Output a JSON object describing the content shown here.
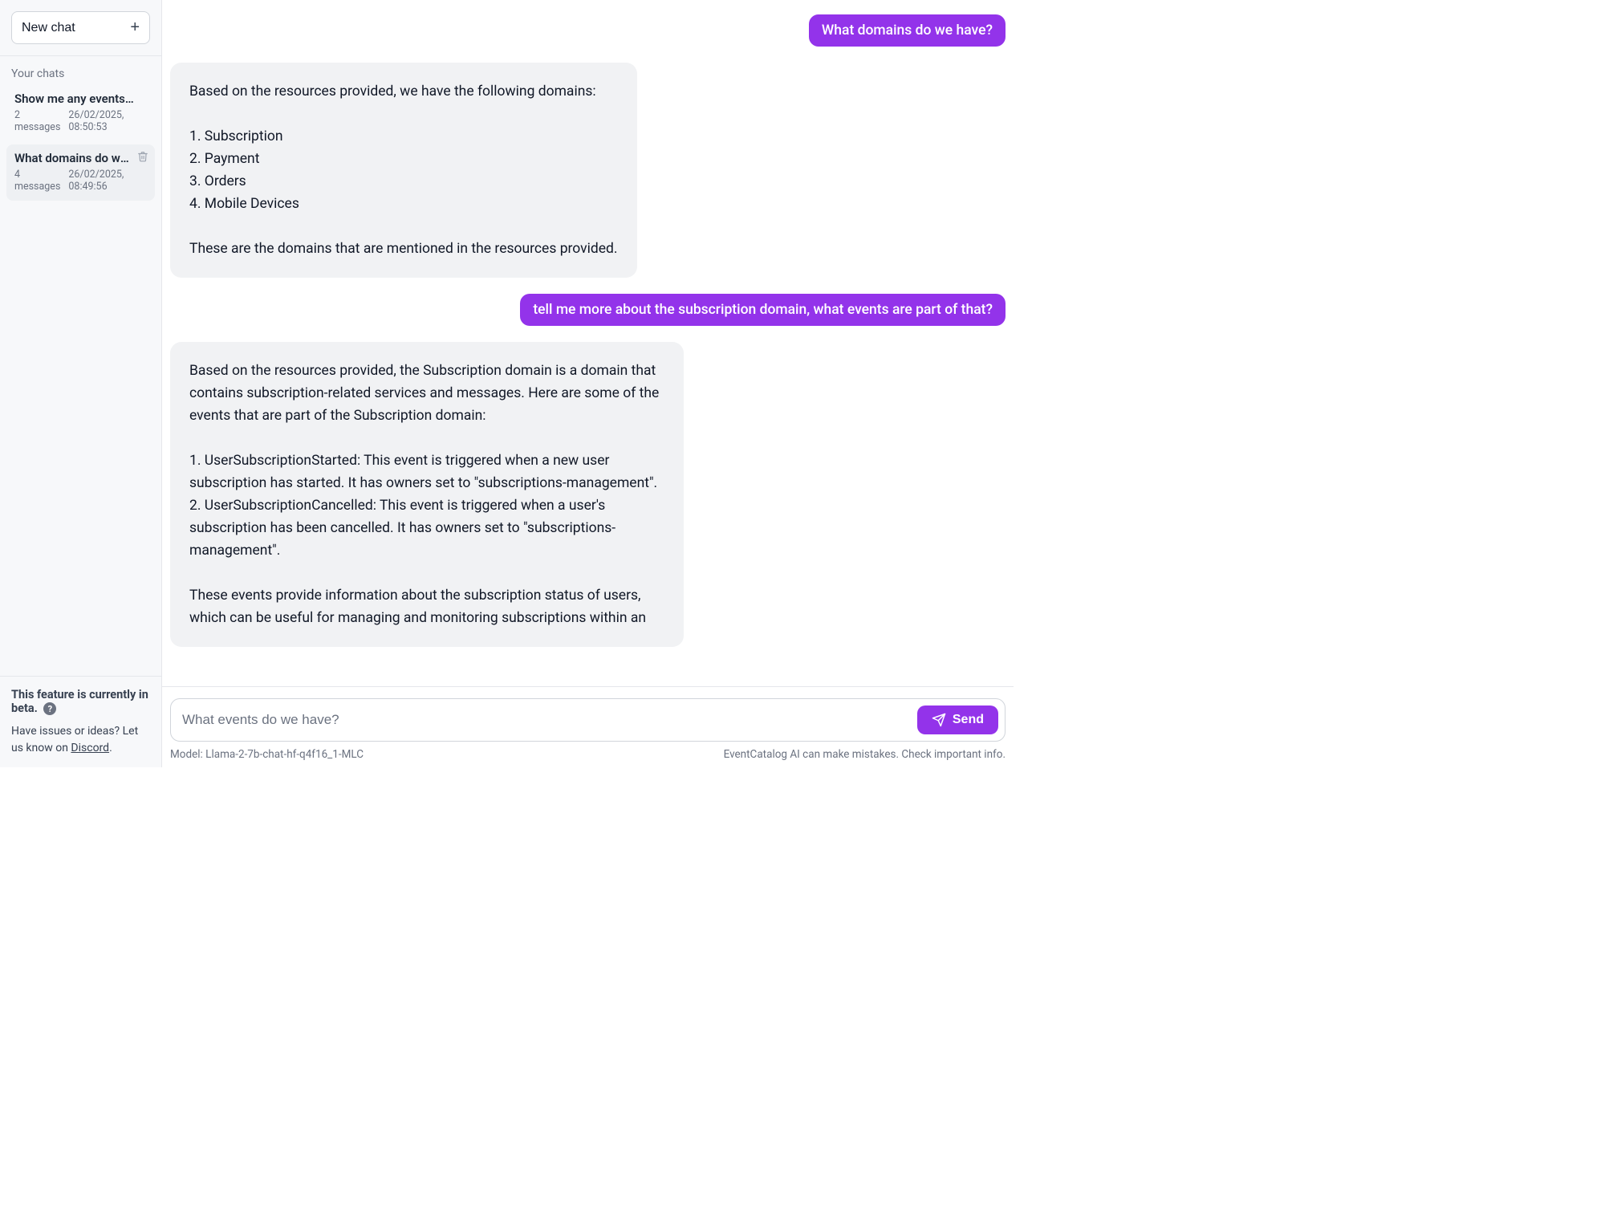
{
  "sidebar": {
    "new_chat": "New chat",
    "your_chats": "Your chats",
    "beta_notice": "This feature is currently in beta.",
    "footer_note_prefix": "Have issues or ideas? Let us know on ",
    "footer_link_text": "Discord",
    "footer_note_suffix": ".",
    "chats": [
      {
        "title": "Show me any events rel...",
        "messages": "2 messages",
        "timestamp": "26/02/2025, 08:50:53",
        "active": false
      },
      {
        "title": "What domains do we have?",
        "messages": "4 messages",
        "timestamp": "26/02/2025, 08:49:56",
        "active": true
      }
    ]
  },
  "conversation": {
    "messages": [
      {
        "role": "user",
        "text": "What domains do we have?"
      },
      {
        "role": "assistant",
        "text": "Based on the resources provided, we have the following domains:\n\n1. Subscription\n2. Payment\n3. Orders\n4. Mobile Devices\n\nThese are the domains that are mentioned in the resources provided."
      },
      {
        "role": "user",
        "text": "tell me more about the subscription domain, what events are part of that?"
      },
      {
        "role": "assistant",
        "text": "Based on the resources provided, the Subscription domain is a domain that contains subscription-related services and messages. Here are some of the events that are part of the Subscription domain:\n\n1. UserSubscriptionStarted: This event is triggered when a new user subscription has started. It has owners set to \"subscriptions-management\".\n2. UserSubscriptionCancelled: This event is triggered when a user's subscription has been cancelled. It has owners set to \"subscriptions-management\".\n\nThese events provide information about the subscription status of users, which can be useful for managing and monitoring subscriptions within an"
      }
    ]
  },
  "composer": {
    "placeholder": "What events do we have?",
    "send_label": "Send"
  },
  "footer": {
    "model_prefix": "Model: ",
    "model_name": "Llama-2-7b-chat-hf-q4f16_1-MLC",
    "disclaimer": "EventCatalog AI can make mistakes. Check important info."
  }
}
